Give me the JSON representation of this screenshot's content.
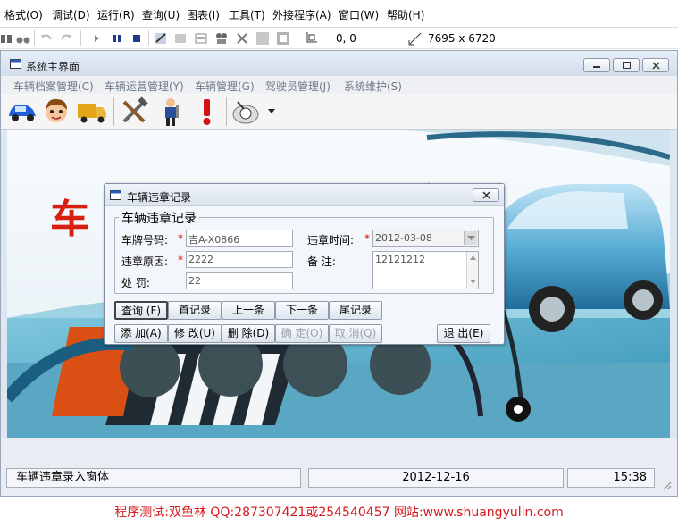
{
  "ide_menu": [
    "格式(O)",
    "调试(D)",
    "运行(R)",
    "查询(U)",
    "图表(I)",
    "工具(T)",
    "外接程序(A)",
    "窗口(W)",
    "帮助(H)"
  ],
  "ide_toolbar": {
    "position": "0, 0",
    "size": "7695 x 6720"
  },
  "main_window": {
    "title": "系统主界面",
    "menu": [
      "车辆档案管理(C)",
      "车辆运营管理(Y)",
      "车辆管理(G)",
      "驾驶员管理(J)",
      "系统维护(S)"
    ],
    "toolbar_icons": [
      "car-icon",
      "driver-avatar-icon",
      "truck-icon",
      "tools-icon",
      "service-person-icon",
      "alert-icon",
      "search-magnifier-icon"
    ]
  },
  "background_art": {
    "big_text": "车"
  },
  "dialog": {
    "title": "车辆违章记录",
    "group_caption": "车辆违章记录",
    "fields": {
      "plate_label": "车牌号码:",
      "plate_value": "吉A-X0866",
      "time_label": "违章时间:",
      "time_value": "2012-03-08",
      "reason_label": "违章原因:",
      "reason_value": "2222",
      "remark_label": "备    注:",
      "remark_value": "12121212",
      "penalty_label": "处    罚:",
      "penalty_value": "22",
      "required_mark": "*"
    },
    "nav_buttons": {
      "query": "查询 (F)",
      "first": "首记录",
      "prev": "上一条",
      "next": "下一条",
      "last": "尾记录"
    },
    "action_buttons": {
      "add": "添 加(A)",
      "edit": "修 改(U)",
      "delete": "删 除(D)",
      "confirm": "确 定(O)",
      "cancel": "取 消(Q)",
      "exit": "退 出(E)"
    }
  },
  "status_bar": {
    "message": "车辆违章录入窗体",
    "date": "2012-12-16",
    "time": "15:38"
  },
  "footer": "程序测试:双鱼林 QQ:287307421或254540457 网站:www.shuangyulin.com",
  "colors": {
    "footer_text": "#d6171b",
    "required": "#d00000",
    "window_frame": "#dde6f1"
  }
}
